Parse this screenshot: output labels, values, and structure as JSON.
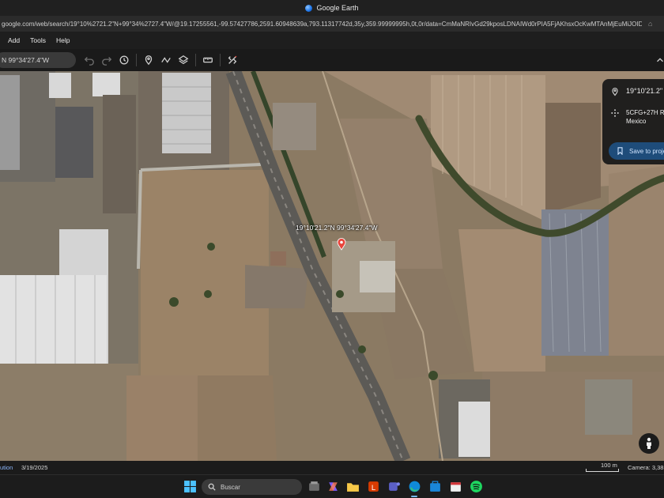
{
  "window": {
    "title": "Google Earth"
  },
  "browser": {
    "url": "google.com/web/search/19°10%2721.2\"N+99°34%2727.4\"W/@19.17255561,-99.57427786,2591.60948639a,793.11317742d,35y,359.99999995h,0t,0r/data=CmMaNRIvGd29kposLDNAIWd0rPIA5FjAKhsxOcKwMTAnMjEuMiJOIDk..."
  },
  "menu": {
    "items": [
      "Add",
      "Tools",
      "Help"
    ]
  },
  "toolbar": {
    "search_value": "N 99°34'27.4\"W",
    "icons": [
      "undo-icon",
      "redo-icon",
      "history-icon",
      "placemark-icon",
      "path-icon",
      "layers-icon",
      "ruler-icon",
      "satellite-icon",
      "expand-icon"
    ]
  },
  "map": {
    "location_label": "19°10'21.2\"N 99°34'27.4\"W"
  },
  "info_panel": {
    "coordinates": "19°10'21.2\"",
    "plus_code_line1": "5CFG+27H R",
    "plus_code_line2": "Mexico",
    "save_label": "Save to proje"
  },
  "status": {
    "attribution": "ution",
    "imagery_date": "3/19/2025",
    "scale": "100 m",
    "camera": "Camera: 3,385"
  },
  "taskbar": {
    "search_placeholder": "Buscar",
    "apps": [
      "start-icon",
      "file-explorer-icon",
      "copilot-icon",
      "folder-icon",
      "office-icon",
      "teams-icon",
      "edge-icon",
      "store-icon",
      "calendar-icon",
      "spotify-icon"
    ]
  },
  "colors": {
    "accent": "#1a73e8",
    "save_button": "#1e4c7a",
    "pin": "#e8453c"
  }
}
